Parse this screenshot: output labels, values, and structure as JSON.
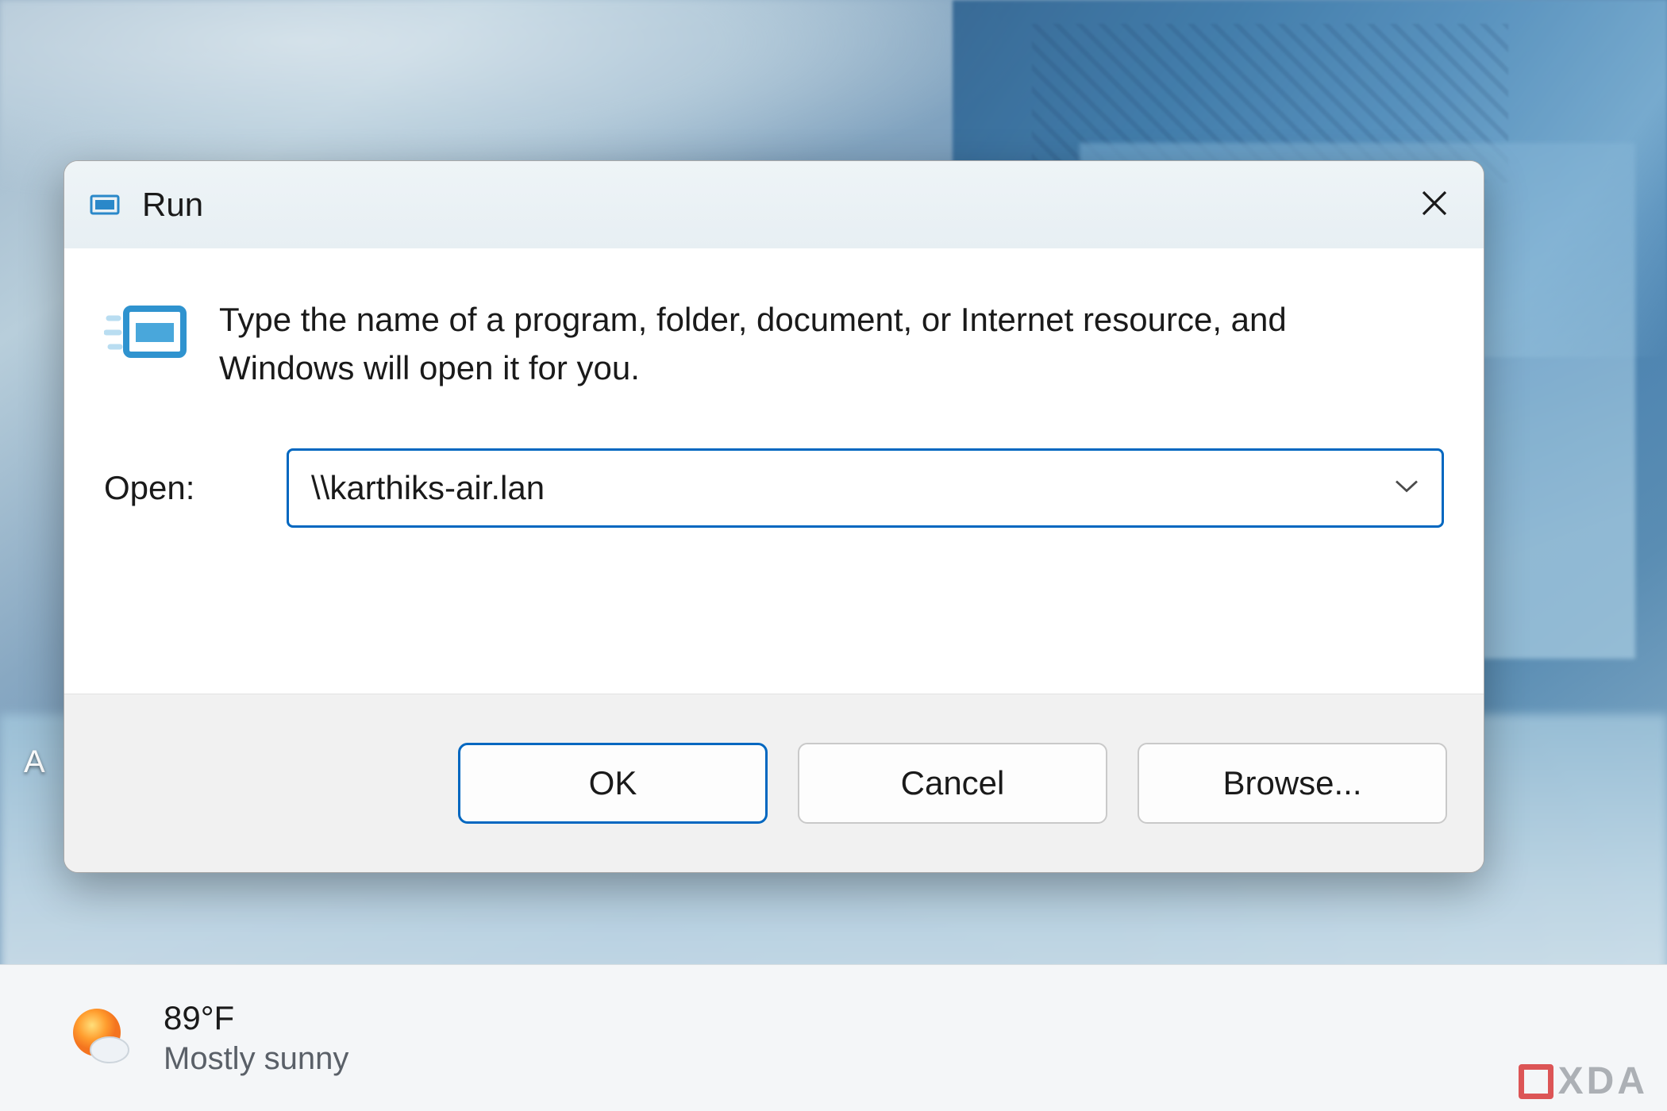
{
  "dialog": {
    "title": "Run",
    "description": "Type the name of a program, folder, document, or Internet resource, and Windows will open it for you.",
    "open_label": "Open:",
    "open_value": "\\\\karthiks-air.lan",
    "buttons": {
      "ok": "OK",
      "cancel": "Cancel",
      "browse": "Browse..."
    }
  },
  "taskbar": {
    "weather": {
      "temperature": "89°F",
      "condition": "Mostly sunny"
    }
  },
  "desktop": {
    "partial_label": "A"
  },
  "watermark": {
    "text": "XDA"
  }
}
